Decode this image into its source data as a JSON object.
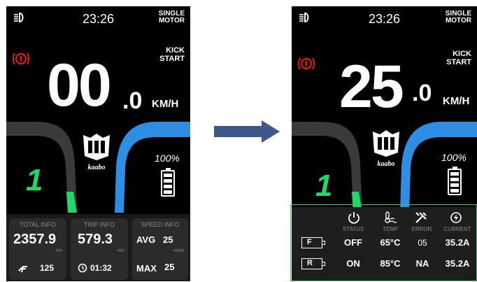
{
  "colors": {
    "accent_blue": "#2f8de4",
    "gear_green": "#23d66a",
    "brake_red": "#e21b1b",
    "arrow_blue": "#3d5a8a",
    "highlight_green": "#44c767"
  },
  "left": {
    "clock": "23:26",
    "motor": "SINGLE\nMOTOR",
    "kick": "KICK\nSTART",
    "speed_int": "00",
    "speed_dec": ".0",
    "unit": "KM/H",
    "gear": "1",
    "battery": "100%",
    "logo_text": "kaabo",
    "panel": {
      "total": {
        "title": "TOTAL INFO",
        "value": "2357.9",
        "unit": "KM",
        "sub": "125"
      },
      "trip": {
        "title": "TRIP INFO",
        "value": "579.3",
        "unit": "KM",
        "sub": "01:32"
      },
      "speed": {
        "title": "SPEED INFO",
        "avg_label": "AVG",
        "avg": "25",
        "unit": "KM/H",
        "max_label": "MAX",
        "max": "25"
      }
    }
  },
  "right": {
    "clock": "23:26",
    "motor": "SINGLE\nMOTOR",
    "kick": "KICK\nSTART",
    "speed_int": "25",
    "speed_dec": ".0",
    "unit": "KM/H",
    "gear": "1",
    "battery": "100%",
    "logo_text": "kaabo",
    "table": {
      "headers": [
        "STATUS",
        "TEMP",
        "ERROR",
        "CURRENT"
      ],
      "rows": [
        {
          "label": "F",
          "status": "OFF",
          "temp": "65°C",
          "error": "05",
          "current": "35.2A"
        },
        {
          "label": "R",
          "status": "ON",
          "temp": "85°C",
          "error": "NA",
          "current": "35.2A"
        }
      ]
    }
  }
}
